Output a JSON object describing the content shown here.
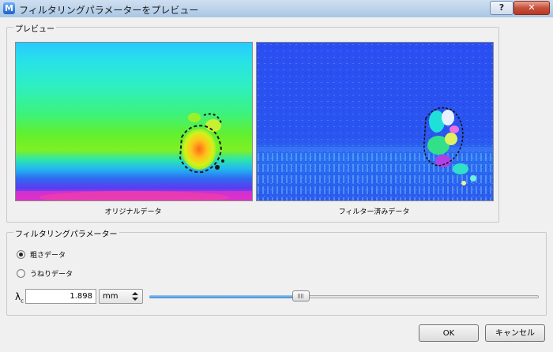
{
  "window": {
    "title": "フィルタリングパラメーターをプレビュー",
    "app_icon_letter": "M",
    "help_glyph": "?",
    "close_glyph": "✕"
  },
  "preview": {
    "group_label": "プレビュー",
    "original_caption": "オリジナルデータ",
    "filtered_caption": "フィルター済みデータ"
  },
  "params": {
    "group_label": "フィルタリングパラメーター",
    "radio_options": [
      {
        "label": "粗さデータ",
        "checked": true
      },
      {
        "label": "うねりデータ",
        "checked": false
      }
    ],
    "lambda_symbol": "λ",
    "lambda_sub": "c",
    "lambda_value": "1.898",
    "unit": "mm",
    "slider_fraction": 0.39
  },
  "buttons": {
    "ok": "OK",
    "cancel": "キャンセル"
  },
  "colors": {
    "slider_fill": "#3d8ad8",
    "title_bar": "#b9d1ea"
  }
}
